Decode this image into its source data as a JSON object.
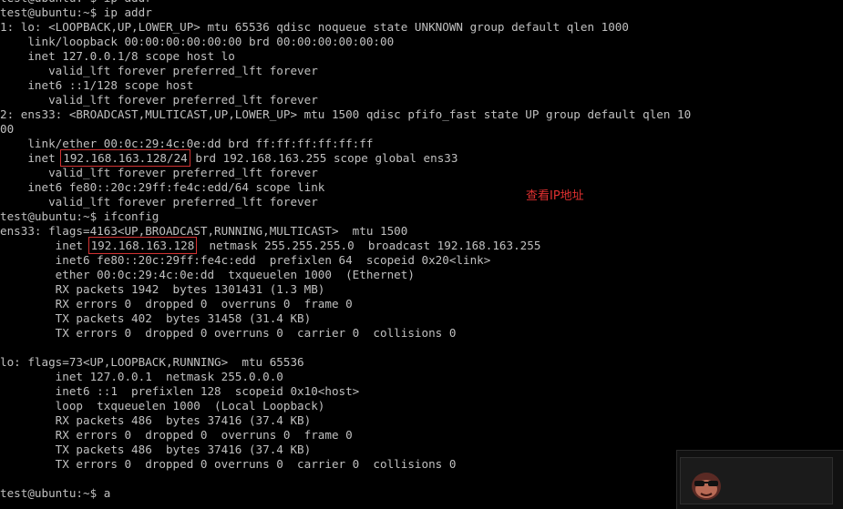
{
  "terminal": {
    "lines": [
      [
        {
          "t": "test@ubuntu:~$ ip addr"
        }
      ],
      [
        {
          "t": "test@ubuntu:~$ ip addr"
        }
      ],
      [
        {
          "t": "1: lo: <LOOPBACK,UP,LOWER_UP> mtu 65536 qdisc noqueue state UNKNOWN group default qlen 1000"
        }
      ],
      [
        {
          "t": "    link/loopback 00:00:00:00:00:00 brd 00:00:00:00:00:00"
        }
      ],
      [
        {
          "t": "    inet 127.0.0.1/8 scope host lo"
        }
      ],
      [
        {
          "t": "       valid_lft forever preferred_lft forever"
        }
      ],
      [
        {
          "t": "    inet6 ::1/128 scope host"
        }
      ],
      [
        {
          "t": "       valid_lft forever preferred_lft forever"
        }
      ],
      [
        {
          "t": "2: ens33: <BROADCAST,MULTICAST,UP,LOWER_UP> mtu 1500 qdisc pfifo_fast state UP group default qlen 10"
        }
      ],
      [
        {
          "t": "00"
        }
      ],
      [
        {
          "t": "    link/ether 00:0c:29:4c:0e:dd brd ff:ff:ff:ff:ff:ff"
        }
      ],
      [
        {
          "t": "    inet "
        },
        {
          "t": "192.168.163.128/24",
          "hl": true
        },
        {
          "t": " brd 192.168.163.255 scope global ens33"
        }
      ],
      [
        {
          "t": "       valid_lft forever preferred_lft forever"
        }
      ],
      [
        {
          "t": "    inet6 fe80::20c:29ff:fe4c:edd/64 scope link"
        }
      ],
      [
        {
          "t": "       valid_lft forever preferred_lft forever"
        }
      ],
      [
        {
          "t": "test@ubuntu:~$ ifconfig"
        }
      ],
      [
        {
          "t": "ens33: flags=4163<UP,BROADCAST,RUNNING,MULTICAST>  mtu 1500"
        }
      ],
      [
        {
          "t": "        inet "
        },
        {
          "t": "192.168.163.128",
          "hl": true
        },
        {
          "t": "  netmask 255.255.255.0  broadcast 192.168.163.255"
        }
      ],
      [
        {
          "t": "        inet6 fe80::20c:29ff:fe4c:edd  prefixlen 64  scopeid 0x20<link>"
        }
      ],
      [
        {
          "t": "        ether 00:0c:29:4c:0e:dd  txqueuelen 1000  (Ethernet)"
        }
      ],
      [
        {
          "t": "        RX packets 1942  bytes 1301431 (1.3 MB)"
        }
      ],
      [
        {
          "t": "        RX errors 0  dropped 0  overruns 0  frame 0"
        }
      ],
      [
        {
          "t": "        TX packets 402  bytes 31458 (31.4 KB)"
        }
      ],
      [
        {
          "t": "        TX errors 0  dropped 0 overruns 0  carrier 0  collisions 0"
        }
      ],
      [
        {
          "t": ""
        }
      ],
      [
        {
          "t": "lo: flags=73<UP,LOOPBACK,RUNNING>  mtu 65536"
        }
      ],
      [
        {
          "t": "        inet 127.0.0.1  netmask 255.0.0.0"
        }
      ],
      [
        {
          "t": "        inet6 ::1  prefixlen 128  scopeid 0x10<host>"
        }
      ],
      [
        {
          "t": "        loop  txqueuelen 1000  (Local Loopback)"
        }
      ],
      [
        {
          "t": "        RX packets 486  bytes 37416 (37.4 KB)"
        }
      ],
      [
        {
          "t": "        RX errors 0  dropped 0  overruns 0  frame 0"
        }
      ],
      [
        {
          "t": "        TX packets 486  bytes 37416 (37.4 KB)"
        }
      ],
      [
        {
          "t": "        TX errors 0  dropped 0 overruns 0  carrier 0  collisions 0"
        }
      ],
      [
        {
          "t": ""
        }
      ],
      [
        {
          "t": "test@ubuntu:~$ a"
        }
      ]
    ]
  },
  "annotation": {
    "text": "查看IP地址"
  },
  "colors": {
    "background": "#000000",
    "text": "#c0c0c0",
    "highlight_box": "#d23232",
    "annotation": "#e03030"
  },
  "watermark": {
    "icon": "cartoon-face-icon"
  }
}
